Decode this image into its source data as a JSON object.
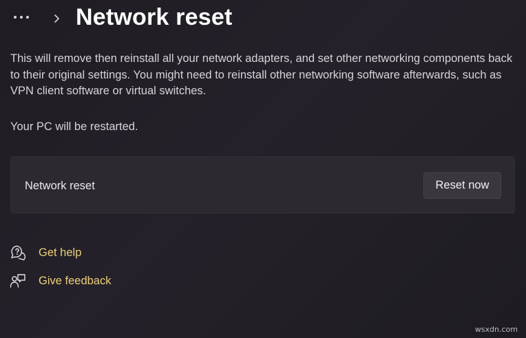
{
  "header": {
    "more_icon": "more-horizontal-icon",
    "chevron_icon": "chevron-right-icon",
    "title": "Network reset"
  },
  "main": {
    "description": "This will remove then reinstall all your network adapters, and set other networking components back to their original settings. You might need to reinstall other networking software afterwards, such as VPN client software or virtual switches.",
    "restart_note": "Your PC will be restarted.",
    "card": {
      "label": "Network reset",
      "button_label": "Reset now"
    }
  },
  "links": {
    "get_help": {
      "label": "Get help",
      "icon": "help-chat-icon"
    },
    "give_feedback": {
      "label": "Give feedback",
      "icon": "feedback-icon"
    }
  },
  "watermark": "wsxdn.com",
  "colors": {
    "background": "#221f26",
    "card": "#2c2a30",
    "button": "#3a383e",
    "link": "#eccf77",
    "title": "#ffffff"
  }
}
